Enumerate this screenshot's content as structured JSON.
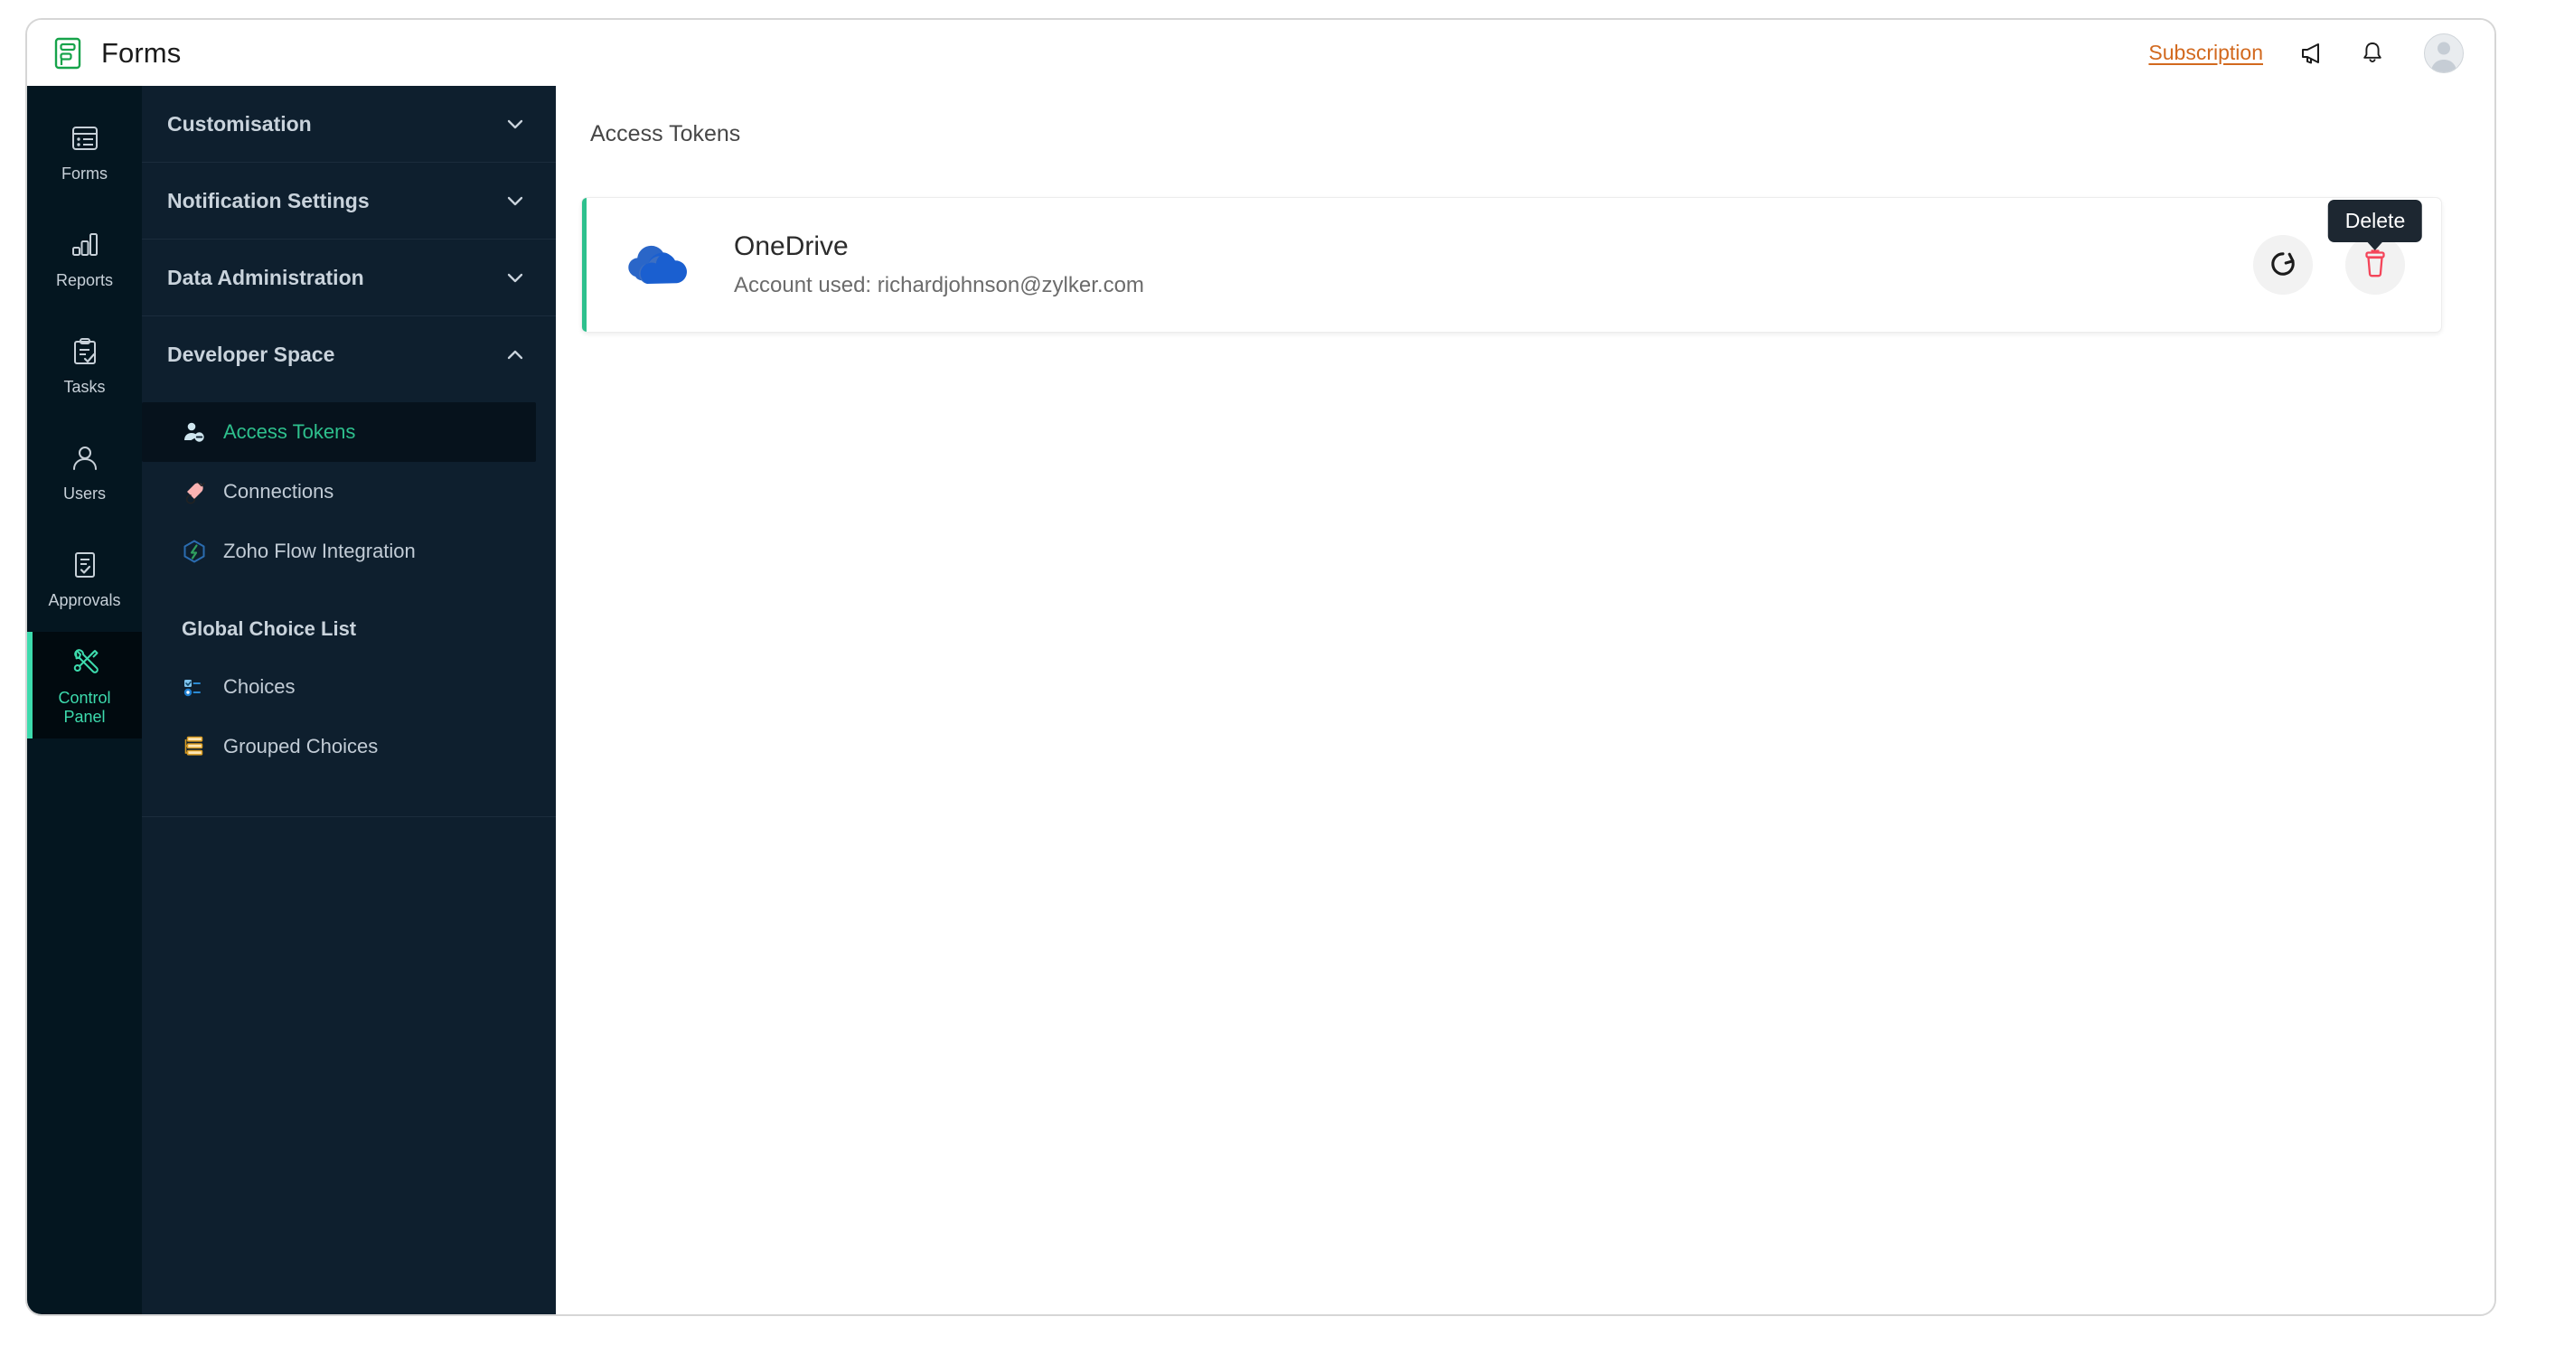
{
  "topbar": {
    "app_name": "Forms",
    "subscription_label": "Subscription",
    "logo_icon": "forms-logo-icon",
    "announcement_icon": "megaphone-icon",
    "notification_icon": "bell-icon",
    "avatar_icon": "user-avatar"
  },
  "rail": {
    "items": [
      {
        "label": "Forms",
        "icon": "forms-list-icon",
        "active": false
      },
      {
        "label": "Reports",
        "icon": "bar-chart-icon",
        "active": false
      },
      {
        "label": "Tasks",
        "icon": "clipboard-check-icon",
        "active": false
      },
      {
        "label": "Users",
        "icon": "user-icon",
        "active": false
      },
      {
        "label": "Approvals",
        "icon": "document-check-icon",
        "active": false
      },
      {
        "label": "Control\nPanel",
        "icon": "tools-icon",
        "active": true
      }
    ],
    "item_labels": {
      "forms": "Forms",
      "reports": "Reports",
      "tasks": "Tasks",
      "users": "Users",
      "approvals": "Approvals",
      "control_panel_line1": "Control",
      "control_panel_line2": "Panel"
    }
  },
  "sidebar": {
    "sections": [
      {
        "title": "Customisation",
        "expanded": false,
        "chevron": "chevron-down-icon"
      },
      {
        "title": "Notification Settings",
        "expanded": false,
        "chevron": "chevron-down-icon"
      },
      {
        "title": "Data Administration",
        "expanded": false,
        "chevron": "chevron-down-icon"
      },
      {
        "title": "Developer Space",
        "expanded": true,
        "chevron": "chevron-up-icon"
      }
    ],
    "developer_space_items": [
      {
        "label": "Access Tokens",
        "icon": "user-token-icon",
        "active": true
      },
      {
        "label": "Connections",
        "icon": "plug-icon",
        "active": false
      },
      {
        "label": "Zoho Flow Integration",
        "icon": "zoho-flow-icon",
        "active": false
      }
    ],
    "group_title": "Global Choice List",
    "global_choice_items": [
      {
        "label": "Choices",
        "icon": "choice-list-icon",
        "active": false
      },
      {
        "label": "Grouped Choices",
        "icon": "grouped-list-icon",
        "active": false
      }
    ]
  },
  "main": {
    "page_title": "Access Tokens",
    "token_card": {
      "service_name": "OneDrive",
      "account_label": "Account used: richardjohnson@zylker.com",
      "service_icon": "onedrive-cloud-icon",
      "refresh_icon": "refresh-icon",
      "delete_icon": "trash-icon",
      "tooltip": "Delete"
    }
  },
  "colors": {
    "accent_teal": "#2ec08d",
    "rail_bg": "#041620",
    "sidebar_bg": "#0e1f2e",
    "subscription_orange": "#d2691e",
    "delete_red": "#f4455a",
    "onedrive_blue": "#1a5fd0",
    "tooltip_bg": "#1d2731"
  }
}
